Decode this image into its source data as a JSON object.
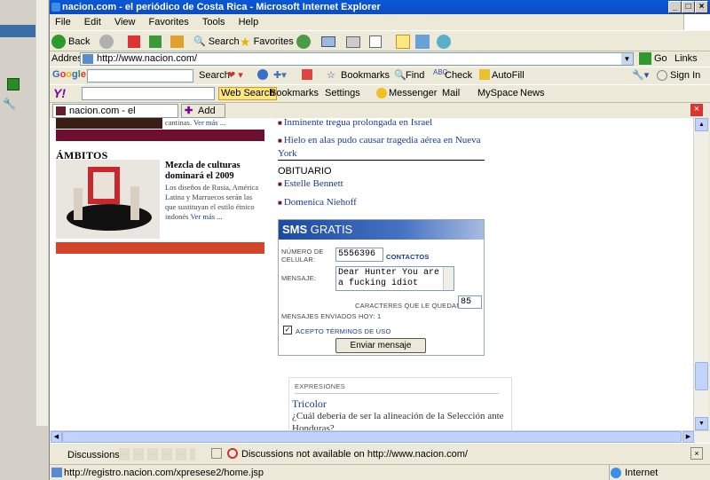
{
  "window": {
    "title": "nacion.com - el periódico de Costa Rica - Microsoft Internet Explorer"
  },
  "menu": [
    "File",
    "Edit",
    "View",
    "Favorites",
    "Tools",
    "Help"
  ],
  "toolbar": {
    "back": "Back",
    "search": "Search",
    "favorites": "Favorites"
  },
  "address": {
    "label": "Address",
    "url": "http://www.nacion.com/",
    "go": "Go",
    "links": "Links"
  },
  "google_bar": {
    "search": "Search",
    "bookmarks": "Bookmarks",
    "find": "Find",
    "check": "Check",
    "autofill": "AutoFill",
    "signin": "Sign In"
  },
  "yahoo_bar": {
    "web_search": "Web Search",
    "bookmarks": "Bookmarks",
    "settings": "Settings",
    "messenger": "Messenger",
    "mail": "Mail",
    "myspace": "MySpace",
    "news": "News"
  },
  "tabs": {
    "current": "nacion.com - el periódico de Cos...",
    "add": "Add Tab"
  },
  "page": {
    "top_left_text": "cantinas.",
    "ver_mas": "Ver más ...",
    "ambitos": {
      "heading": "ÁMBITOS",
      "title": "Mezcla de culturas dominará el 2009",
      "body": "Los diseños de Rusia, América Latina y Marruecos serán las que sustituyan el estilo étnico indonés",
      "more": "Ver más ..."
    },
    "news_links": [
      "Inminente tregua prolongada en Israel",
      "Hielo en alas pudo causar tragedia aérea en Nueva York"
    ],
    "obituario": {
      "heading": "OBITUARIO",
      "items": [
        "Estelle Bennett",
        "Domenica Niehoff"
      ]
    },
    "sms": {
      "brand_a": "SMS",
      "brand_b": "GRATIS",
      "numero_label": "NÚMERO DE CELULAR:",
      "numero_value": "5556396",
      "contactos": "CONTACTOS",
      "mensaje_label": "MENSAJE:",
      "mensaje_value": "Dear Hunter You are a fucking idiot",
      "quedan_label": "CARACTERES QUE LE QUEDAN",
      "quedan_value": "85",
      "enviados_label": "MENSAJES ENVIADOS HOY:",
      "enviados_value": "1",
      "acepto": "ACEPTO TÉRMINOS DE USO",
      "enviar": "Enviar mensaje"
    },
    "expresiones": {
      "heading": "EXPRESIONES",
      "link": "Tricolor",
      "question": "¿Cuál debería de ser la alineación de la Selección ante Honduras?"
    }
  },
  "discussions": {
    "label": "Discussions",
    "status": "Discussions not available on http://www.nacion.com/"
  },
  "status": {
    "url": "http://registro.nacion.com/xpresese2/home.jsp",
    "zone": "Internet"
  },
  "colors": {
    "maroon": "#6e0f2f",
    "orange_bar": "#d2452a",
    "ie_blue": "#0a58d6"
  }
}
